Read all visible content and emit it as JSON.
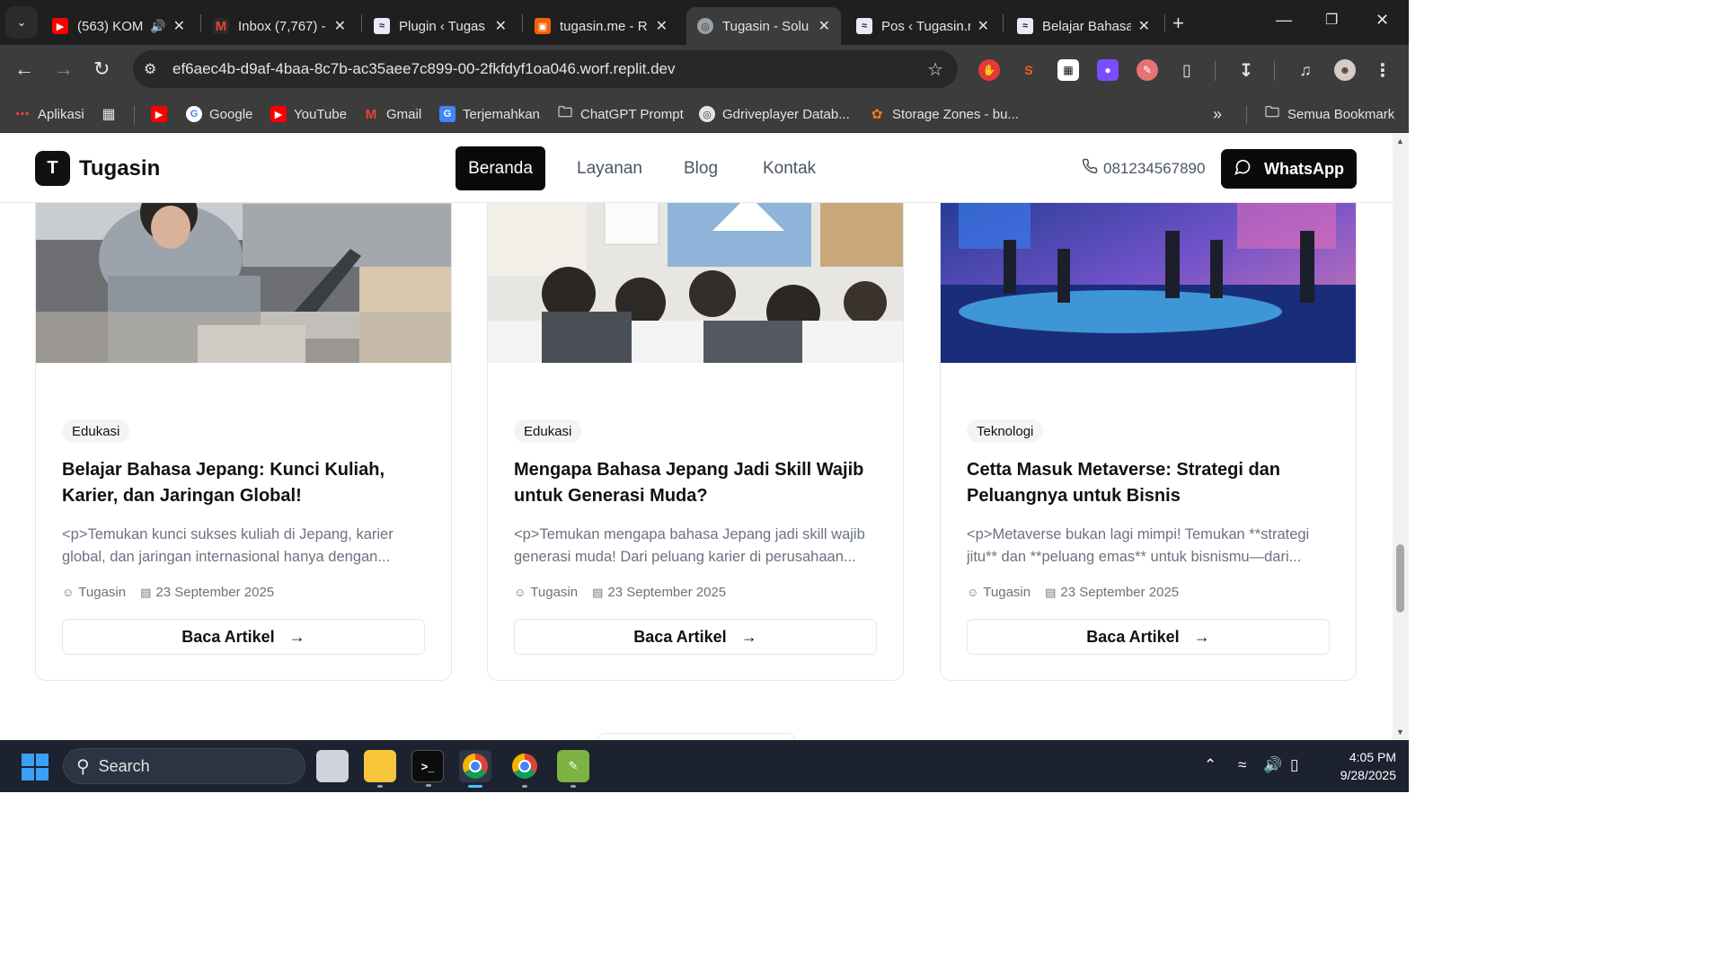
{
  "browser": {
    "tabs": [
      {
        "title": "(563) KOM",
        "favicon": "youtube-icon",
        "color": "#ff0000",
        "audio": true
      },
      {
        "title": "Inbox (7,767) -",
        "favicon": "gmail-icon",
        "color": "#ea4335"
      },
      {
        "title": "Plugin ‹ Tugas",
        "favicon": "wordpress-icon",
        "color": "#2c3e50"
      },
      {
        "title": "tugasin.me - R",
        "favicon": "replit-icon",
        "color": "#f26207"
      },
      {
        "title": "Tugasin - Solu",
        "favicon": "globe-icon",
        "color": "#9aa0a6",
        "active": true
      },
      {
        "title": "Pos ‹ Tugasin.r",
        "favicon": "wordpress-icon",
        "color": "#2c3e50"
      },
      {
        "title": "Belajar Bahasa",
        "favicon": "wordpress-icon",
        "color": "#2c3e50"
      }
    ],
    "url": "ef6aec4b-d9af-4baa-8c7b-ac35aee7c899-00-2fkfdyf1oa046.worf.replit.dev",
    "bookmarks": [
      {
        "label": "Aplikasi",
        "icon": "apps-grid-icon"
      },
      {
        "label": "",
        "icon": "tab-groups-icon"
      },
      {
        "label": "",
        "icon": "youtube-icon"
      },
      {
        "label": "Google",
        "icon": "google-icon"
      },
      {
        "label": "YouTube",
        "icon": "youtube-icon"
      },
      {
        "label": "Gmail",
        "icon": "gmail-icon"
      },
      {
        "label": "Terjemahkan",
        "icon": "translate-icon"
      },
      {
        "label": "ChatGPT Prompt",
        "icon": "folder-icon"
      },
      {
        "label": "Gdriveplayer Datab...",
        "icon": "globe-icon"
      },
      {
        "label": "Storage Zones - bu...",
        "icon": "bunny-icon"
      }
    ],
    "all_bookmarks_label": "Semua Bookmark"
  },
  "site": {
    "logo_letter": "T",
    "brand": "Tugasin",
    "nav": [
      "Beranda",
      "Layanan",
      "Blog",
      "Kontak"
    ],
    "active_nav": "Beranda",
    "phone": "081234567890",
    "whatsapp_label": "WhatsApp"
  },
  "articles": [
    {
      "category": "Edukasi",
      "title": "Belajar Bahasa Jepang: Kunci Kuliah, Karier, dan Jaringan Global!",
      "excerpt": "<p>Temukan kunci sukses kuliah di Jepang, karier global, dan jaringan internasional hanya dengan...",
      "author": "Tugasin",
      "date": "23 September 2025",
      "button": "Baca Artikel"
    },
    {
      "category": "Edukasi",
      "title": "Mengapa Bahasa Jepang Jadi Skill Wajib untuk Generasi Muda?",
      "excerpt": "<p>Temukan mengapa bahasa Jepang jadi skill wajib generasi muda! Dari peluang karier di perusahaan...",
      "author": "Tugasin",
      "date": "23 September 2025",
      "button": "Baca Artikel"
    },
    {
      "category": "Teknologi",
      "title": "Cetta Masuk Metaverse: Strategi dan Peluangnya untuk Bisnis",
      "excerpt": "<p>Metaverse bukan lagi mimpi! Temukan **strategi jitu** dan **peluang emas** untuk bisnismu—dari...",
      "author": "Tugasin",
      "date": "23 September 2025",
      "button": "Baca Artikel"
    }
  ],
  "taskbar": {
    "search_placeholder": "Search",
    "time": "4:05 PM",
    "date": "9/28/2025"
  }
}
